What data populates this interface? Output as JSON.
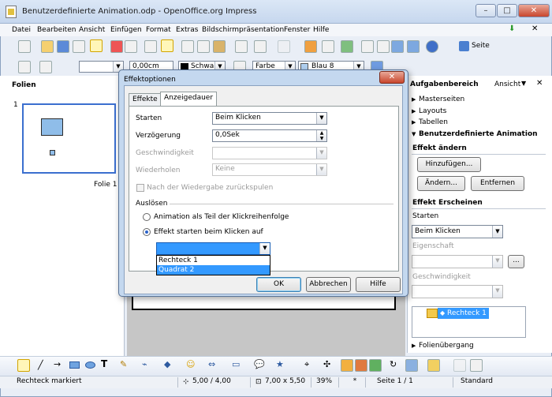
{
  "window": {
    "title": "Benutzerdefinierte Animation.odp - OpenOffice.org Impress"
  },
  "menu": [
    "Datei",
    "Bearbeiten",
    "Ansicht",
    "Einfügen",
    "Format",
    "Extras",
    "Bildschirmpräsentation",
    "Fenster",
    "Hilfe"
  ],
  "toolbar2": {
    "line_width": "0,00cm",
    "line_color": "Schwarz",
    "area_style": "Farbe",
    "area_color": "Blau 8"
  },
  "toolbar1": {
    "page_label": "Seite"
  },
  "slides_pane": {
    "title": "Folien",
    "slide_number": "1",
    "slide_name": "Folie 1"
  },
  "task_pane": {
    "title": "Aufgabenbereich",
    "view": "Ansicht",
    "sections": [
      "Masterseiten",
      "Layouts",
      "Tabellen",
      "Benutzerdefinierte Animation"
    ],
    "modify_effect": "Effekt ändern",
    "add_button": "Hinzufügen...",
    "change_button": "Ändern...",
    "remove_button": "Entfernen",
    "effect_heading": "Effekt Erscheinen",
    "start_label": "Starten",
    "start_value": "Beim Klicken",
    "property_label": "Eigenschaft",
    "speed_label": "Geschwindigkeit",
    "effect_item": "Rechteck 1",
    "transition": "Folienübergang"
  },
  "dialog": {
    "title": "Effektoptionen",
    "tabs": [
      "Effekte",
      "Anzeigedauer"
    ],
    "start_label": "Starten",
    "start_value": "Beim Klicken",
    "delay_label": "Verzögerung",
    "delay_value": "0,0Sek",
    "speed_label": "Geschwindigkeit",
    "repeat_label": "Wiederholen",
    "repeat_value": "Keine",
    "rewind_label": "Nach der Wiedergabe zurückspulen",
    "trigger_heading": "Auslösen",
    "radio_sequence": "Animation als Teil der Klickreihenfolge",
    "radio_click": "Effekt starten beim Klicken auf",
    "dropdown_options": [
      "Rechteck 1",
      "Quadrat 2"
    ],
    "ok": "OK",
    "cancel": "Abbrechen",
    "help": "Hilfe"
  },
  "status": {
    "message": "Rechteck markiert",
    "position": "5,00 / 4,00",
    "size": "7,00 x 5,50",
    "zoom": "39%",
    "modified": "*",
    "page": "Seite 1 / 1",
    "layout": "Standard"
  }
}
